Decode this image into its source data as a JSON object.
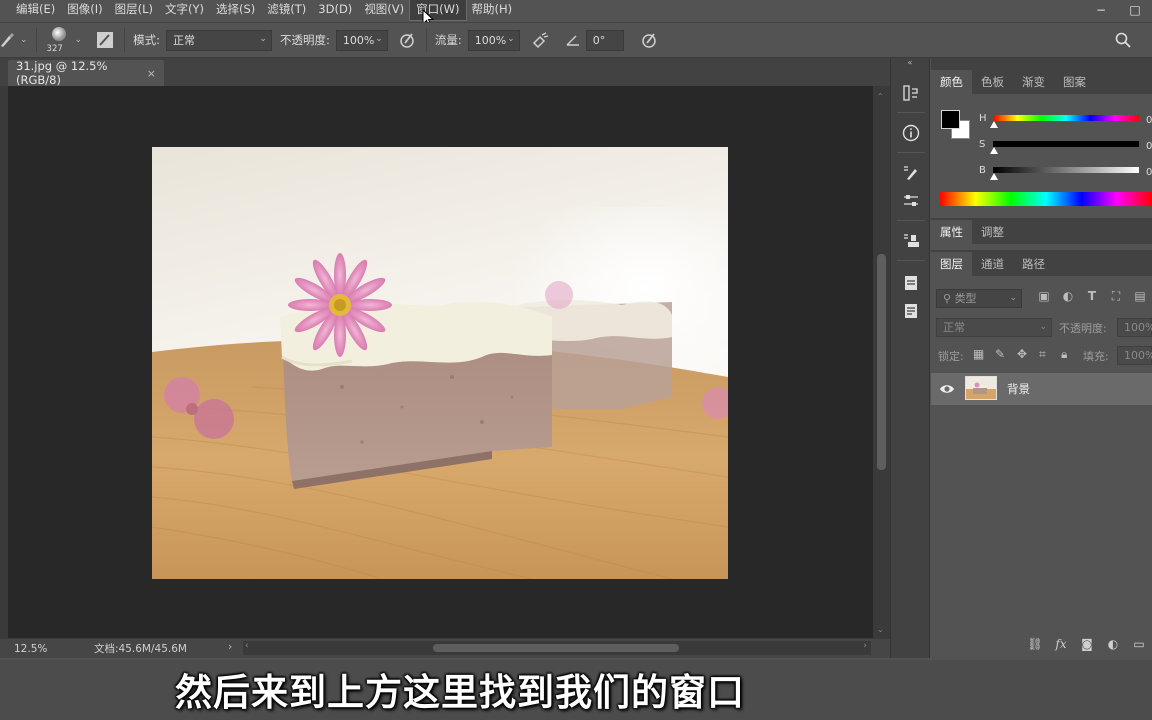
{
  "menubar": {
    "items": [
      {
        "label": "编辑(E)"
      },
      {
        "label": "图像(I)"
      },
      {
        "label": "图层(L)"
      },
      {
        "label": "文字(Y)"
      },
      {
        "label": "选择(S)"
      },
      {
        "label": "滤镜(T)"
      },
      {
        "label": "3D(D)"
      },
      {
        "label": "视图(V)"
      },
      {
        "label": "窗口(W)"
      },
      {
        "label": "帮助(H)"
      }
    ],
    "active_item": "窗口(W)",
    "window_controls": {
      "minimize": "−",
      "maximize": "□"
    }
  },
  "options": {
    "brush_size": "327",
    "mode_label": "模式:",
    "mode_value": "正常",
    "opacity_label": "不透明度:",
    "opacity_value": "100%",
    "flow_label": "流量:",
    "flow_value": "100%",
    "angle_value": "0°",
    "icons": [
      "brush-tool-icon",
      "brush-preset-icon",
      "brush-settings-icon",
      "pressure-opacity-icon",
      "airbrush-icon",
      "angle-icon",
      "pressure-size-icon",
      "search-icon"
    ]
  },
  "document": {
    "tab_title": "31.jpg @ 12.5%(RGB/8)",
    "tab_close": "×",
    "zoom": "12.5%",
    "doc_info": "文档:45.6M/45.6M"
  },
  "subtitle": "然后来到上方这里找到我们的窗口",
  "panels": {
    "color_tabs": [
      "颜色",
      "色板",
      "渐变",
      "图案"
    ],
    "color_active": "颜色",
    "hsb": [
      {
        "label": "H",
        "value": "0"
      },
      {
        "label": "S",
        "value": "0"
      },
      {
        "label": "B",
        "value": "0"
      }
    ],
    "foreground_color": "#000000",
    "background_color": "#ffffff",
    "props_tabs": [
      "属性",
      "调整"
    ],
    "props_active": "属性",
    "layers_tabs": [
      "图层",
      "通道",
      "路径"
    ],
    "layers_active": "图层",
    "filter_placeholder": "类型",
    "blend_mode": "正常",
    "opacity_label": "不透明度:",
    "opacity_value": "100%",
    "lock_label": "锁定:",
    "fill_label": "填充:",
    "fill_value": "100%",
    "layers": [
      {
        "name": "背景",
        "visible": true
      }
    ]
  },
  "colors": {
    "ui_bg": "#535353",
    "canvas_bg": "#282828",
    "accent_selected_layer": "#6a6a6a"
  }
}
